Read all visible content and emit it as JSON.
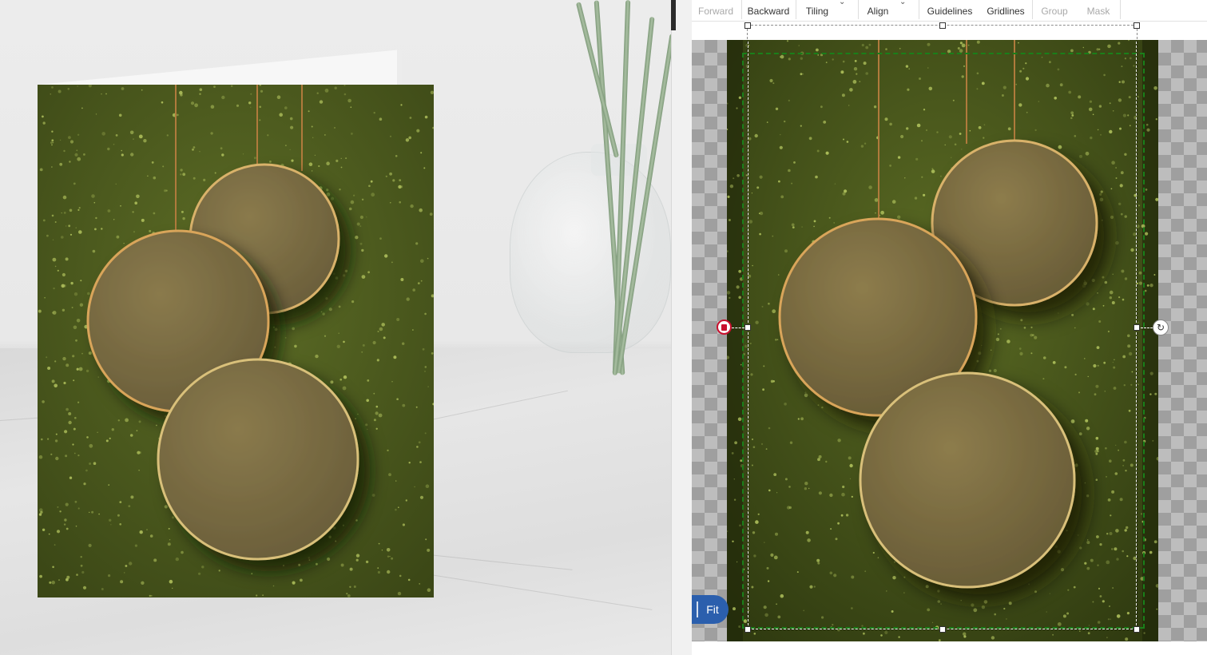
{
  "toolbar": {
    "items": [
      {
        "label": "Forward",
        "enabled": false
      },
      {
        "label": "Backward",
        "enabled": true
      },
      {
        "label": "Tiling",
        "enabled": true
      },
      {
        "label": "Align",
        "enabled": true
      },
      {
        "label": "Guidelines",
        "enabled": true
      },
      {
        "label": "Gridlines",
        "enabled": true
      },
      {
        "label": "Group",
        "enabled": false
      },
      {
        "label": "Mask",
        "enabled": false
      }
    ]
  },
  "canvas": {
    "fit_label": "Fit",
    "delete_icon": "trash-icon",
    "rotate_icon": "rotate-icon"
  },
  "colors": {
    "selection_green": "#1a7f1a",
    "fit_button": "#2b5fad",
    "delete_red": "#c8102e",
    "glitter_green": "#4f5e1e",
    "ornament_gold": "#7d6e45"
  }
}
